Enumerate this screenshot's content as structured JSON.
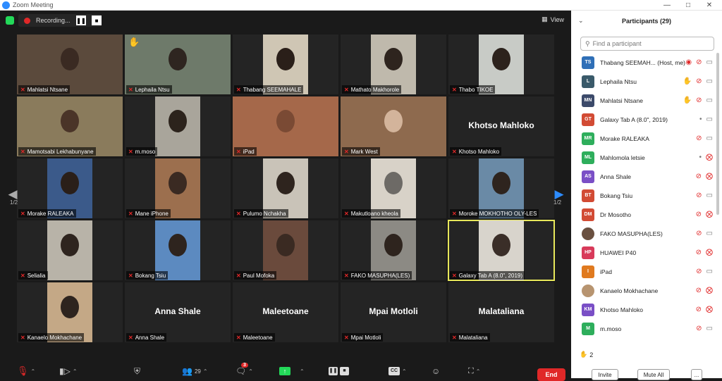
{
  "window": {
    "title": "Zoom Meeting"
  },
  "topbar": {
    "recording": "Recording...",
    "view": "View"
  },
  "page_indicator": "1/2",
  "tiles": [
    {
      "name": "Mahlatsi Ntsane",
      "kind": "video",
      "bg": "#5b4a3c",
      "face": "#3a2a22"
    },
    {
      "name": "Lephaila Ntsu",
      "kind": "video",
      "bg": "#6e7a6a",
      "face": "#2e2520",
      "hand": true
    },
    {
      "name": "Thabang SEEMAHALE",
      "kind": "video",
      "bg": "#cfc6b4",
      "face": "#2a1f19"
    },
    {
      "name": "Mathato Makhorole",
      "kind": "video",
      "bg": "#bfb9ac",
      "face": "#2e241e"
    },
    {
      "name": "Thabo TIKOE",
      "kind": "video",
      "bg": "#c8cbc6",
      "face": "#2c221c"
    },
    {
      "name": "Mamotsabi Lekhabunyane",
      "kind": "video",
      "bg": "#8a7b5c",
      "face": "#4a3428"
    },
    {
      "name": "m.moso",
      "kind": "video",
      "bg": "#a9a59b",
      "face": "#2c231c"
    },
    {
      "name": "iPad",
      "kind": "video",
      "bg": "#a5684a",
      "face": "#7a4a34"
    },
    {
      "name": "Mark West",
      "kind": "video",
      "bg": "#8e6a4e",
      "face": "#d3b49b"
    },
    {
      "name": "Khotso Mahloko",
      "kind": "name",
      "display": "Khotso Mahloko"
    },
    {
      "name": "Morake RALEAKA",
      "kind": "video",
      "bg": "#3b5a8a",
      "face": "#2a1f19"
    },
    {
      "name": "Mane iPhone",
      "kind": "video",
      "bg": "#9c6f4e",
      "face": "#3a2a22"
    },
    {
      "name": "Pulumo Nchakha",
      "kind": "video",
      "bg": "#c9c3b8",
      "face": "#2e241e"
    },
    {
      "name": "Makutloano kheola",
      "kind": "video",
      "bg": "#d8d2c8",
      "face": "#6d6a66"
    },
    {
      "name": "Moroke MOKHOTHO OLY-LES",
      "kind": "video",
      "bg": "#6a8aa6",
      "face": "#2e241e"
    },
    {
      "name": "Selialia",
      "kind": "video",
      "bg": "#b8b3a8",
      "face": "#2e241e"
    },
    {
      "name": "Bokang Tsiu",
      "kind": "video",
      "bg": "#5c8ac0",
      "face": "#2e241e"
    },
    {
      "name": "Paul Mofoka",
      "kind": "video",
      "bg": "#6a4a3c",
      "face": "#3a2a22"
    },
    {
      "name": "FAKO MASUPHA(LES)",
      "kind": "video",
      "bg": "#8c8a84",
      "face": "#2e241e"
    },
    {
      "name": "Galaxy Tab A (8.0\", 2019)",
      "kind": "video",
      "bg": "#d8d4cc",
      "face": "#3a2e28",
      "active": true
    },
    {
      "name": "Kanaelo Mokhachane",
      "kind": "video",
      "bg": "#c4a886",
      "face": "#2e241e"
    },
    {
      "name": "Anna Shale",
      "kind": "name",
      "display": "Anna Shale"
    },
    {
      "name": "Maleetoane",
      "kind": "name",
      "display": "Maleetoane"
    },
    {
      "name": "Mpai Motloli",
      "kind": "name",
      "display": "Mpai Motloli"
    },
    {
      "name": "Malataliana",
      "kind": "name",
      "display": "Malataliana"
    }
  ],
  "toolbar": {
    "participants_count": "29",
    "chat_badge": "3",
    "end": "End"
  },
  "panel": {
    "title": "Participants (29)",
    "search_placeholder": "Find a participant",
    "participants": [
      {
        "initials": "TS",
        "name": "Thabang SEEMAH... (Host, me)",
        "color": "#2f6fb7",
        "status": "rec",
        "mic": "muted",
        "cam": "on"
      },
      {
        "initials": "L",
        "name": "Lephaila Ntsu",
        "color": "#3a5a6a",
        "status": "hand",
        "mic": "muted",
        "cam": "on"
      },
      {
        "initials": "MN",
        "name": "Mahlatsi Ntsane",
        "color": "#3c4a6a",
        "status": "hand-dark",
        "mic": "muted",
        "cam": "on"
      },
      {
        "initials": "GT",
        "name": "Galaxy Tab A (8.0\", 2019)",
        "color": "#d24b34",
        "status": "",
        "mic": "on",
        "cam": "on"
      },
      {
        "initials": "MR",
        "name": "Morake RALEAKA",
        "color": "#2eae5c",
        "status": "",
        "mic": "muted",
        "cam": "on"
      },
      {
        "initials": "ML",
        "name": "Mahlomola letsie",
        "color": "#2eae5c",
        "status": "",
        "mic": "on",
        "cam": "off"
      },
      {
        "initials": "AS",
        "name": "Anna Shale",
        "color": "#7a4fc6",
        "status": "",
        "mic": "muted",
        "cam": "off"
      },
      {
        "initials": "BT",
        "name": "Bokang Tsiu",
        "color": "#d24b34",
        "status": "",
        "mic": "muted",
        "cam": "on"
      },
      {
        "initials": "DM",
        "name": "Dr Mosotho",
        "color": "#d24b34",
        "status": "",
        "mic": "muted",
        "cam": "off"
      },
      {
        "initials": "",
        "name": "FAKO MASUPHA(LES)",
        "color": "#6a5040",
        "status": "",
        "mic": "muted",
        "cam": "on"
      },
      {
        "initials": "HP",
        "name": "HUAWEI P40",
        "color": "#d83a5a",
        "status": "",
        "mic": "muted",
        "cam": "off"
      },
      {
        "initials": "I",
        "name": "iPad",
        "color": "#e07a1f",
        "status": "",
        "mic": "muted",
        "cam": "on"
      },
      {
        "initials": "",
        "name": "Kanaelo Mokhachane",
        "color": "#b79470",
        "status": "",
        "mic": "muted",
        "cam": "off"
      },
      {
        "initials": "KM",
        "name": "Khotso Mahloko",
        "color": "#7a4fc6",
        "status": "",
        "mic": "muted",
        "cam": "off"
      },
      {
        "initials": "M",
        "name": "m.moso",
        "color": "#2eae5c",
        "status": "",
        "mic": "muted",
        "cam": "on"
      }
    ],
    "hand_count": "2",
    "invite": "Invite",
    "mute_all": "Mute All",
    "more": "..."
  },
  "colors": {
    "accent": "#2d8cff",
    "danger": "#e02828",
    "active_border": "#e8e85a",
    "green": "#23d959"
  }
}
